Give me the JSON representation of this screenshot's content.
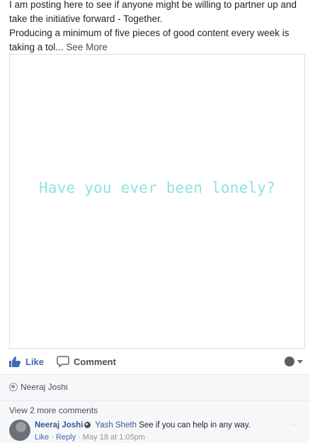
{
  "post": {
    "line1": "I am posting here to see if anyone might be willing to partner up and take the initiative forward - Together.",
    "line2": "Producing a minimum of five pieces of good content every week is taking a tol...",
    "see_more": "See More"
  },
  "media": {
    "caption": "Have you ever been lonely?",
    "caption_color": "#8fe3de"
  },
  "actions": {
    "like_label": "Like",
    "comment_label": "Comment",
    "like_color": "#4267b2",
    "like_icon": "thumbs-up-icon",
    "comment_icon": "speech-bubble-icon",
    "audience_icon": "avatar-dropdown-icon"
  },
  "reactions": {
    "reactor_name": "Neeraj Joshi"
  },
  "comments": {
    "view_more": "View 2 more comments",
    "items": [
      {
        "author": "Neeraj Joshi",
        "mention": "Yash Sheth",
        "text": "See if you can help in any way.",
        "like": "Like",
        "reply": "Reply",
        "time": "May 18 at 1:05pm",
        "more_icon": "ellipsis-icon"
      }
    ]
  }
}
